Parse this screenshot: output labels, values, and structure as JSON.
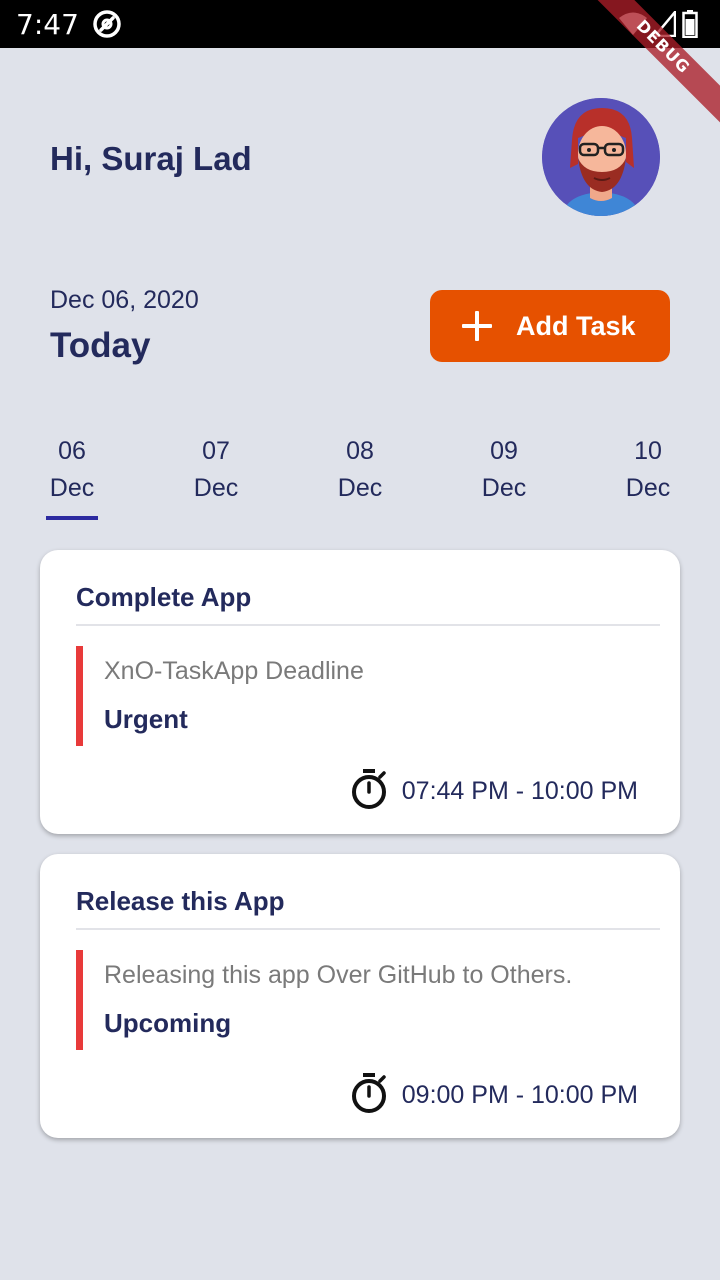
{
  "status_bar": {
    "time": "7:47",
    "icons": [
      "app-notification-icon",
      "wifi-icon",
      "signal-icon",
      "battery-icon"
    ]
  },
  "debug_banner": "DEBUG",
  "header": {
    "greeting": "Hi, Suraj Lad"
  },
  "date_header": {
    "date": "Dec 06, 2020",
    "label": "Today",
    "add_task_label": "Add Task"
  },
  "date_strip": [
    {
      "day": "06",
      "month": "Dec",
      "selected": true
    },
    {
      "day": "07",
      "month": "Dec",
      "selected": false
    },
    {
      "day": "08",
      "month": "Dec",
      "selected": false
    },
    {
      "day": "09",
      "month": "Dec",
      "selected": false
    },
    {
      "day": "10",
      "month": "Dec",
      "selected": false
    }
  ],
  "tasks": [
    {
      "title": "Complete App",
      "description": "XnO-TaskApp Deadline",
      "priority": "Urgent",
      "time": "07:44 PM - 10:00 PM"
    },
    {
      "title": "Release this App",
      "description": "Releasing this app Over GitHub to Others.",
      "priority": "Upcoming",
      "time": "09:00 PM - 10:00 PM"
    }
  ],
  "colors": {
    "background": "#dfe2ea",
    "primary_text": "#232a5c",
    "accent_orange": "#e65100",
    "priority_bar": "#e83a3a",
    "selected_underline": "#2c2aa0"
  }
}
